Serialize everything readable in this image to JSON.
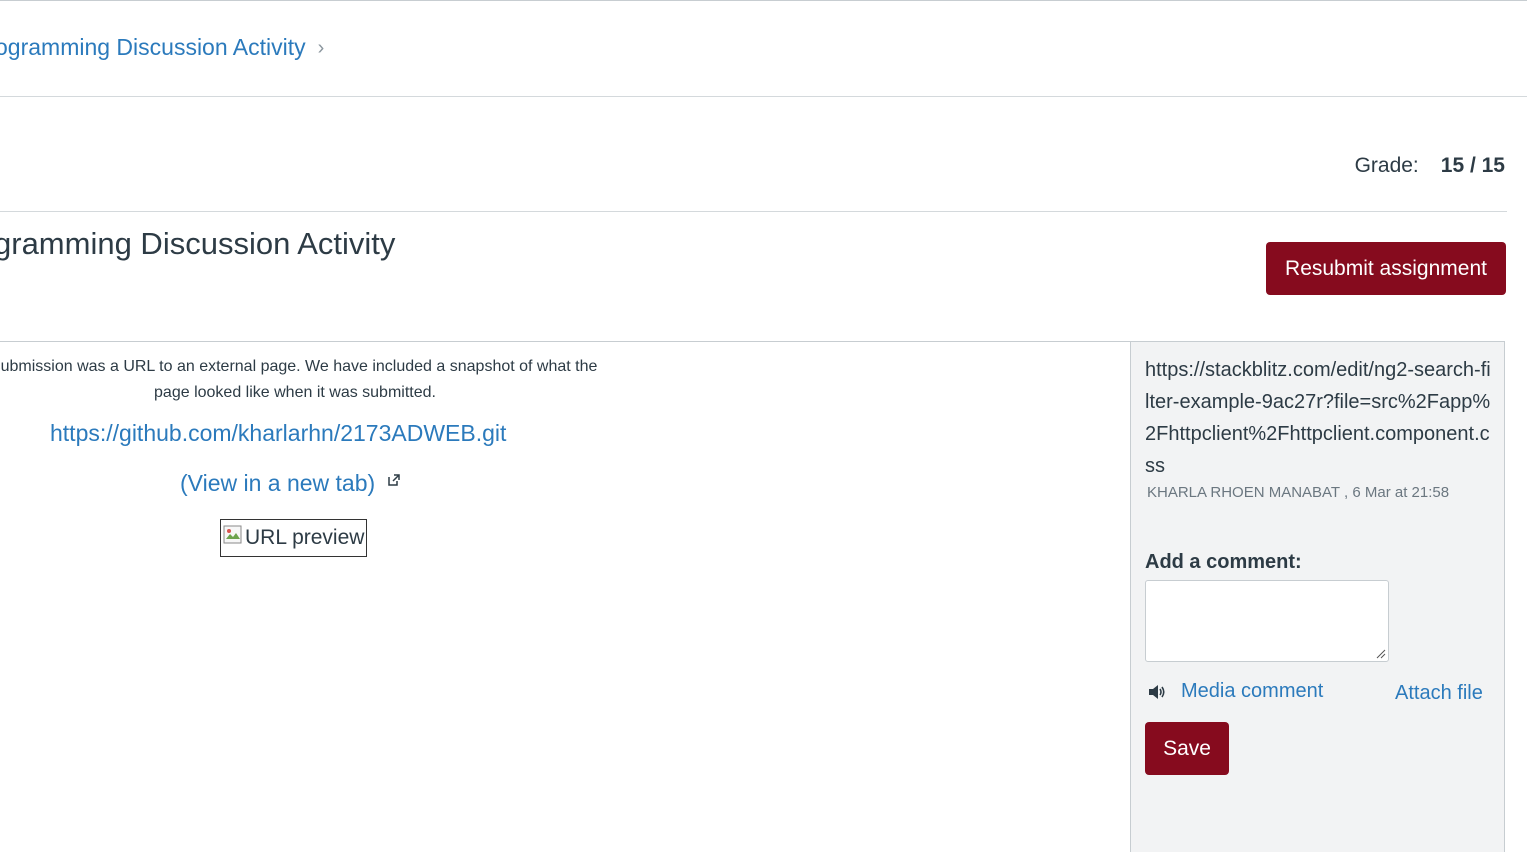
{
  "breadcrumb": {
    "assignment_link": "ogramming Discussion Activity"
  },
  "grade": {
    "label": "Grade:",
    "value": "15 / 15"
  },
  "assignment": {
    "title": "gramming Discussion Activity",
    "resubmit_label": "Resubmit assignment"
  },
  "submission": {
    "notice_line1": "submission was a URL to an external page. We have included a snapshot of what the",
    "notice_line2": "page looked like when it was submitted.",
    "url": "https://github.com/kharlarhn/2173ADWEB.git",
    "view_new_tab": "(View in a new tab)",
    "preview_alt": "URL preview"
  },
  "comments": {
    "existing": [
      {
        "text": "https://stackblitz.com/edit/ng2-search-filter-example-9ac27r?file=src%2Fapp%2Fhttpclient%2Fhttpclient.component.css",
        "author": "KHARLA RHOEN MANABAT",
        "date": "6 Mar at 21:58"
      }
    ],
    "add_label": "Add a comment:",
    "media_comment_label": "Media comment",
    "attach_file_label": "Attach file",
    "save_label": "Save"
  },
  "colors": {
    "link": "#2b7abc",
    "primary_button": "#860b1e",
    "panel_bg": "#f2f3f4"
  }
}
